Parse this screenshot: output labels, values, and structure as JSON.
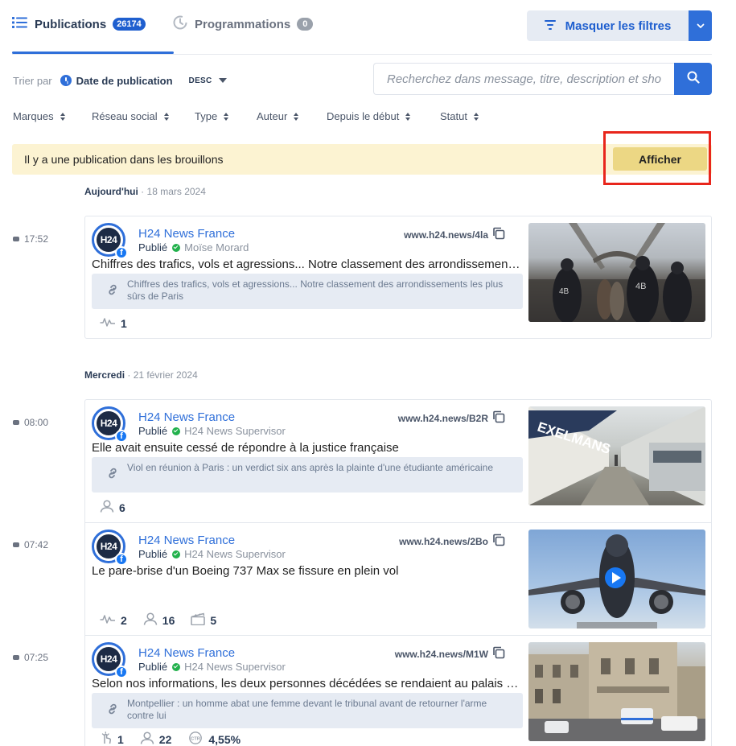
{
  "tabs": [
    {
      "label": "Publications",
      "badge": "26174"
    },
    {
      "label": "Programmations",
      "badge": "0"
    }
  ],
  "header": {
    "filters_label": "Masquer les filtres"
  },
  "sort": {
    "label": "Trier par",
    "field": "Date de publication",
    "direction": "DESC"
  },
  "search": {
    "placeholder": "Recherchez dans message, titre, description et sho"
  },
  "filters": [
    "Marques",
    "Réseau social",
    "Type",
    "Auteur",
    "Depuis le début",
    "Statut"
  ],
  "draft": {
    "message": "Il y a une publication dans les brouillons",
    "button": "Afficher"
  },
  "groups": [
    {
      "day": "Aujourd'hui",
      "date": "18 mars 2024",
      "posts": [
        {
          "time": "17:52",
          "account": "H24 News France",
          "avatar_text": "H24",
          "status": "Publié",
          "author": "Moïse Morard",
          "link": "www.h24.news/4la",
          "text": "Chiffres des trafics, vols et agressions... Notre classement des arrondissements les plus sûrs de Paris",
          "preview": "Chiffres des trafics, vols et agressions... Notre classement des arrondissements les plus sûrs de Paris",
          "stats": [
            {
              "icon": "pulse-icon",
              "value": "1"
            }
          ]
        }
      ]
    },
    {
      "day": "Mercredi",
      "date": "21 février 2024",
      "posts": [
        {
          "time": "08:00",
          "account": "H24 News France",
          "avatar_text": "H24",
          "status": "Publié",
          "author": "H24 News Supervisor",
          "link": "www.h24.news/B2R",
          "text": "Elle avait ensuite cessé de répondre à la justice française",
          "preview": "Viol en réunion à Paris : un verdict six ans après la plainte d'une étudiante américaine",
          "stats": [
            {
              "icon": "user-icon",
              "value": "6"
            }
          ]
        },
        {
          "time": "07:42",
          "account": "H24 News France",
          "avatar_text": "H24",
          "status": "Publié",
          "author": "H24 News Supervisor",
          "link": "www.h24.news/2Bo",
          "text": "Le pare-brise d'un Boeing 737 Max se fissure en plein vol",
          "stats": [
            {
              "icon": "pulse-icon",
              "value": "2"
            },
            {
              "icon": "user-icon",
              "value": "16"
            },
            {
              "icon": "clapperboard-icon",
              "value": "5"
            }
          ]
        },
        {
          "time": "07:25",
          "account": "H24 News France",
          "avatar_text": "H24",
          "status": "Publié",
          "author": "H24 News Supervisor",
          "link": "www.h24.news/M1W",
          "text": "Selon nos informations, les deux personnes décédées se rendaient au palais de justice de Montpellier",
          "preview": "Montpellier : un homme abat une femme devant le tribunal avant de retourner l'arme contre lui",
          "stats": [
            {
              "icon": "click-icon",
              "value": "1"
            },
            {
              "icon": "user-icon",
              "value": "22"
            },
            {
              "icon": "ctr-icon",
              "value": "4,55%"
            }
          ]
        }
      ]
    }
  ],
  "colors": {
    "accent": "#2f6fd9",
    "draft_bg": "#fcf3d2",
    "draft_button": "#ecd784",
    "highlight": "#e8261c",
    "status_ok": "#22b14c"
  }
}
